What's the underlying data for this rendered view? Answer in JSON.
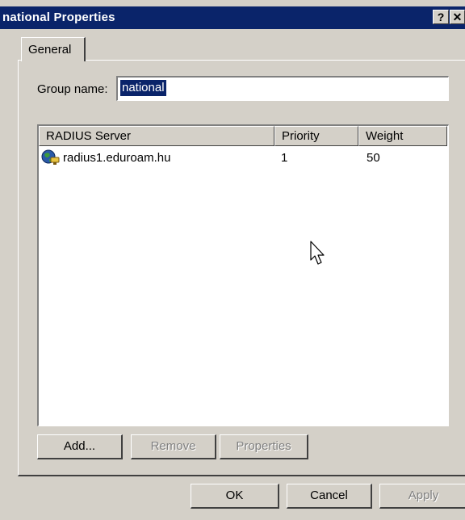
{
  "window": {
    "title": "national Properties",
    "help_label": "?",
    "close_label": "✕"
  },
  "tabs": [
    {
      "label": "General"
    }
  ],
  "group": {
    "label": "Group name:",
    "value": "national"
  },
  "list": {
    "columns": [
      "RADIUS Server",
      "Priority",
      "Weight"
    ],
    "rows": [
      {
        "server": "radius1.eduroam.hu",
        "priority": "1",
        "weight": "50",
        "icon": "server-globe-icon"
      }
    ]
  },
  "list_buttons": {
    "add": "Add...",
    "remove": "Remove",
    "properties": "Properties"
  },
  "dialog_buttons": {
    "ok": "OK",
    "cancel": "Cancel",
    "apply": "Apply"
  },
  "colors": {
    "titlebar": "#0a246a",
    "face": "#d4d0c8",
    "selection": "#0a246a"
  }
}
